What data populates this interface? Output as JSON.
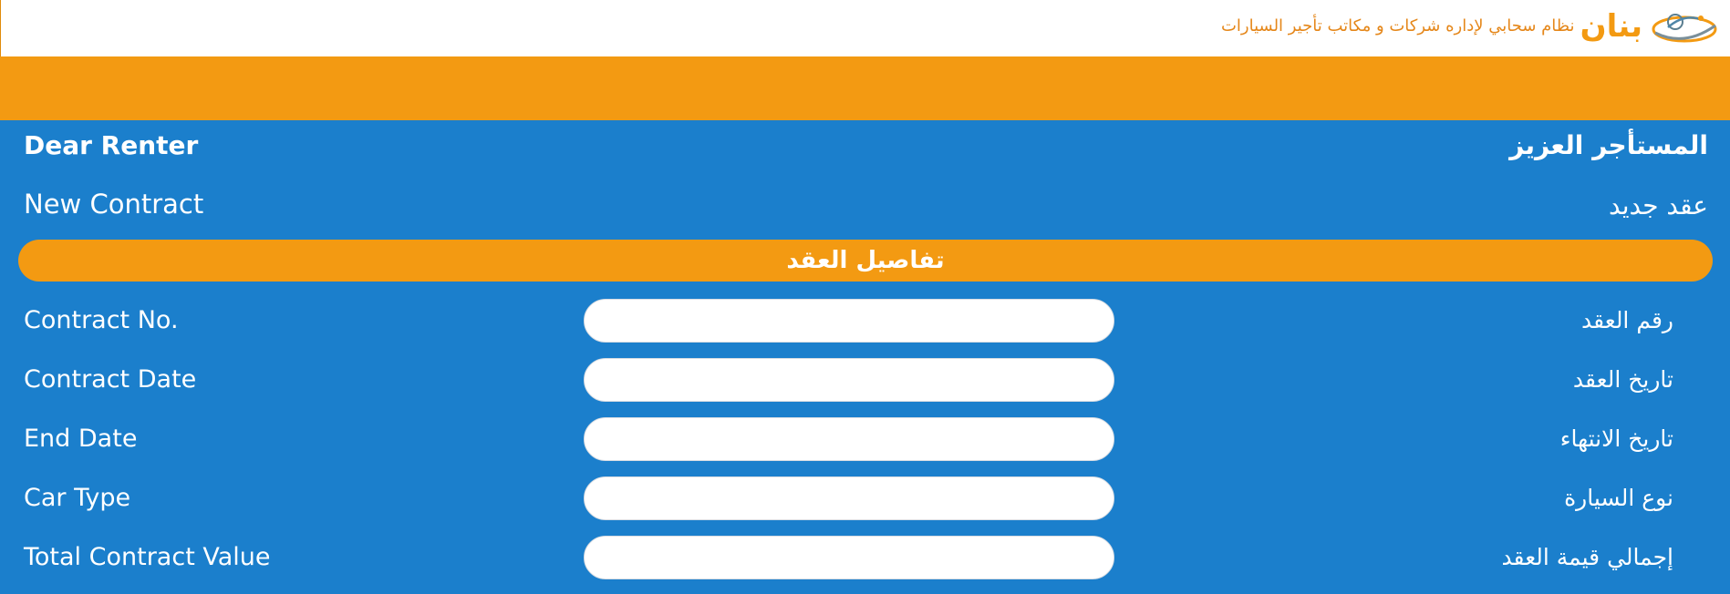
{
  "header": {
    "brand_name": "بنان",
    "tagline": "نظام سحابي لإداره شركات و مكاتب تأجير السيارات",
    "logo_icon": "car-swoosh-logo-icon",
    "brand_color": "#f39a12"
  },
  "colors": {
    "orange": "#f39a12",
    "blue": "#1b7fcc",
    "white": "#ffffff"
  },
  "greeting": {
    "en": "Dear Renter",
    "ar": "المستأجر العزيز"
  },
  "contract": {
    "en": "New Contract",
    "ar": "عقد جديد"
  },
  "section": {
    "title": "تفاصيل العقد"
  },
  "fields": [
    {
      "en": "Contract No.",
      "ar": "رقم العقد",
      "value": "",
      "placeholder": ""
    },
    {
      "en": "Contract Date",
      "ar": "تاريخ العقد",
      "value": "",
      "placeholder": ""
    },
    {
      "en": "End Date",
      "ar": "تاريخ الانتهاء",
      "value": "",
      "placeholder": ""
    },
    {
      "en": "Car Type",
      "ar": "نوع السيارة",
      "value": "",
      "placeholder": ""
    },
    {
      "en": "Total Contract Value",
      "ar": "إجمالي قيمة العقد",
      "value": "",
      "placeholder": ""
    }
  ]
}
